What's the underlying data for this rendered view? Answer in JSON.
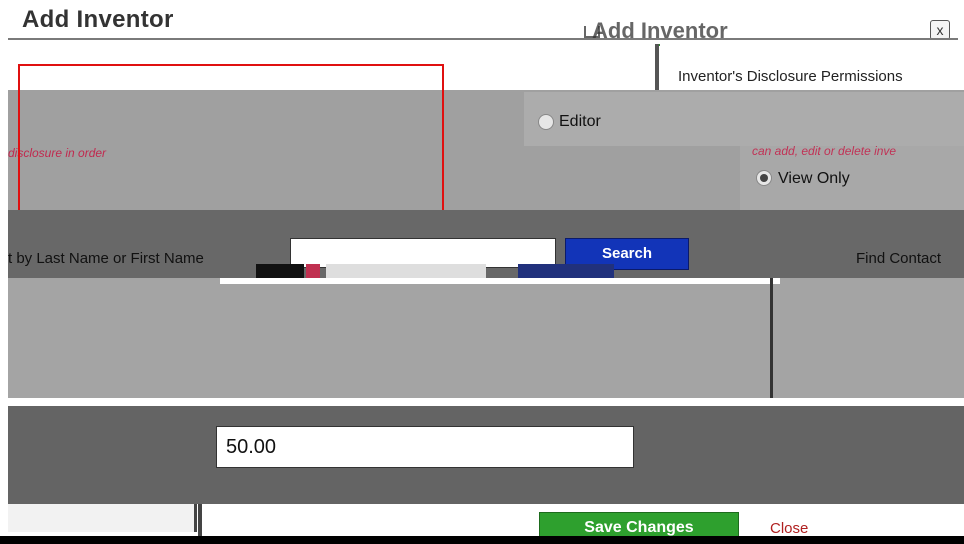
{
  "dialog": {
    "title": "Add Inventor",
    "title_echo": "Add Inventor",
    "close_label": "x"
  },
  "permissions": {
    "heading": "Inventor's Disclosure Permissions",
    "option_editor": "Editor",
    "option_view_only": "View Only",
    "selected": "View Only",
    "editor_hint": "disclosure in order",
    "view_hint": "can add, edit or delete inve"
  },
  "search": {
    "label": "t by Last Name or First Name",
    "input_value": "",
    "button_label": "Search",
    "find_contact_label": "Find Contact"
  },
  "percent": {
    "value": "50.00"
  },
  "footer": {
    "save_label": "Save Changes",
    "close_label": "Close"
  }
}
